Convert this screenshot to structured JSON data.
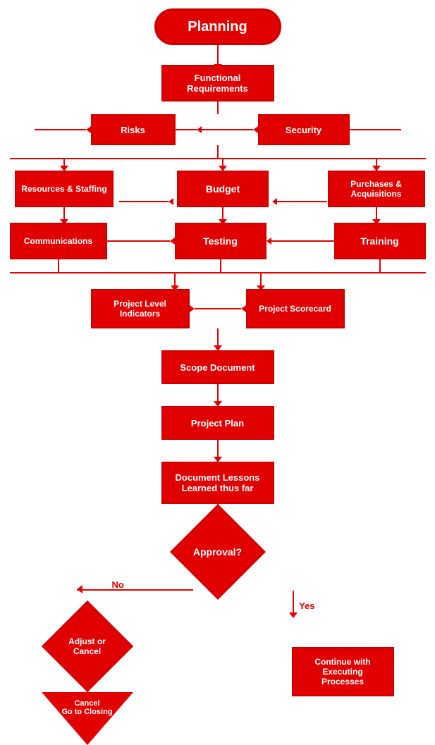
{
  "chart": {
    "title": "Planning",
    "nodes": {
      "functional_requirements": "Functional\nRequirements",
      "risks": "Risks",
      "security": "Security",
      "resources_staffing": "Resources & Staffing",
      "budget": "Budget",
      "purchases_acquisitions": "Purchases &\nAcquisitions",
      "communications": "Communications",
      "testing": "Testing",
      "training": "Training",
      "project_level_indicators": "Project Level\nIndicators",
      "project_scorecard": "Project Scorecard",
      "scope_document": "Scope Document",
      "project_plan": "Project Plan",
      "document_lessons": "Document Lessons\nLearned thus far",
      "approval": "Approval?",
      "adjust_or_cancel": "Adjust or\nCancel",
      "cancel_closing": "Cancel\nGo to Closing",
      "continue_executing": "Continue with\nExecuting\nProcesses"
    },
    "labels": {
      "no": "No",
      "yes": "Yes"
    }
  }
}
